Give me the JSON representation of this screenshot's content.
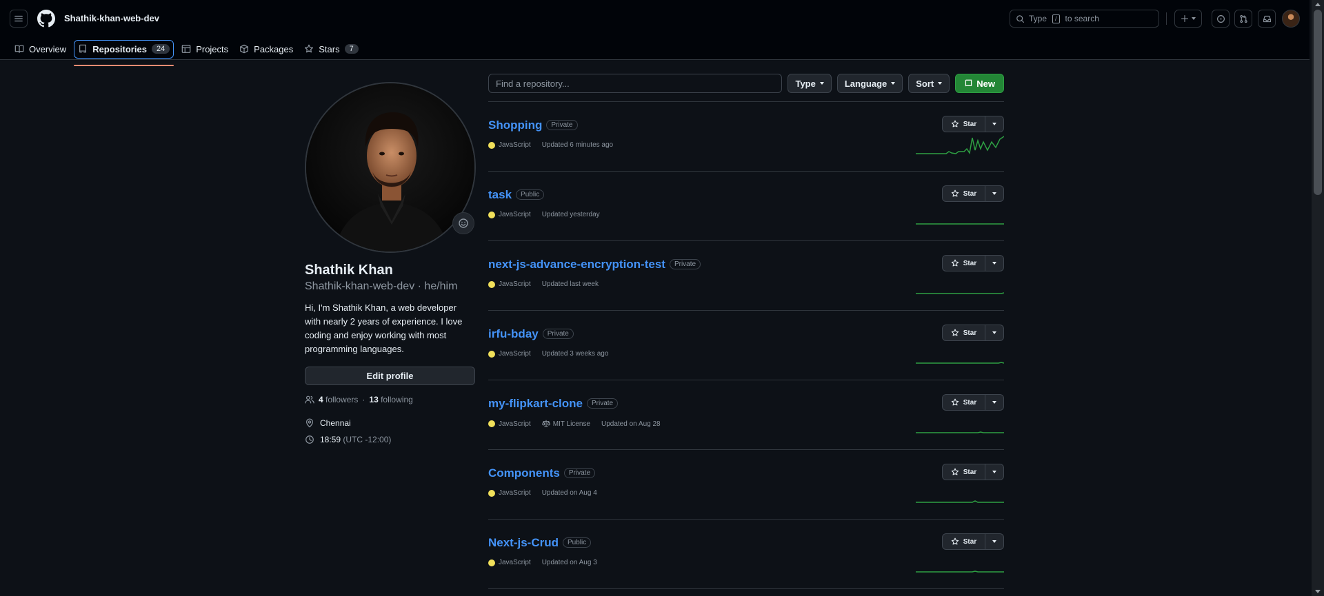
{
  "header": {
    "owner": "Shathik-khan-web-dev",
    "search_placeholder": "Type / to search",
    "search_prefix": "Type",
    "search_key": "/",
    "search_suffix": "to search"
  },
  "tabs": [
    {
      "label": "Overview",
      "icon": "book-icon"
    },
    {
      "label": "Repositories",
      "icon": "repo-icon",
      "count": "24",
      "selected": true
    },
    {
      "label": "Projects",
      "icon": "table-icon"
    },
    {
      "label": "Packages",
      "icon": "package-icon"
    },
    {
      "label": "Stars",
      "icon": "star-icon",
      "count": "7"
    }
  ],
  "profile": {
    "name": "Shathik Khan",
    "login_line": "Shathik-khan-web-dev · he/him",
    "bio": "Hi, I'm Shathik Khan, a web developer with nearly 2 years of experience. I love coding and enjoy working with most programming languages.",
    "edit_label": "Edit profile",
    "followers_count": "4",
    "followers_label": "followers",
    "separator": "·",
    "following_count": "13",
    "following_label": "following",
    "location": "Chennai",
    "time": "18:59",
    "timezone": "(UTC -12:00)"
  },
  "filters": {
    "find_placeholder": "Find a repository...",
    "type_label": "Type",
    "language_label": "Language",
    "sort_label": "Sort",
    "new_label": "New"
  },
  "colors": {
    "accent_link": "#4493f8",
    "primary_button": "#238636",
    "javascript": "#f1e05a",
    "selected_tab_underline": "#fd8c73",
    "sparkline": "#2ea043"
  },
  "repos": [
    {
      "name": "Shopping",
      "visibility": "Private",
      "language": "JavaScript",
      "updated": "Updated 6 minutes ago",
      "star": "Star"
    },
    {
      "name": "task",
      "visibility": "Public",
      "language": "JavaScript",
      "updated": "Updated yesterday",
      "star": "Star"
    },
    {
      "name": "next-js-advance-encryption-test",
      "visibility": "Private",
      "language": "JavaScript",
      "updated": "Updated last week",
      "star": "Star"
    },
    {
      "name": "irfu-bday",
      "visibility": "Private",
      "language": "JavaScript",
      "updated": "Updated 3 weeks ago",
      "star": "Star"
    },
    {
      "name": "my-flipkart-clone",
      "visibility": "Private",
      "language": "JavaScript",
      "license": "MIT License",
      "updated": "Updated on Aug 28",
      "star": "Star"
    },
    {
      "name": "Components",
      "visibility": "Private",
      "language": "JavaScript",
      "updated": "Updated on Aug 4",
      "star": "Star"
    },
    {
      "name": "Next-js-Crud",
      "visibility": "Public",
      "language": "JavaScript",
      "updated": "Updated on Aug 3",
      "star": "Star"
    }
  ]
}
